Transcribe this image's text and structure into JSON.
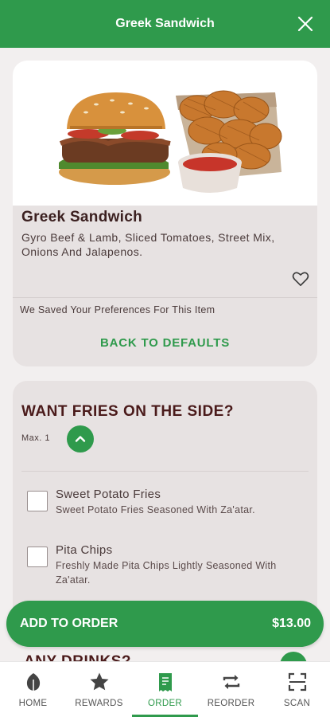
{
  "header": {
    "title": "Greek Sandwich",
    "close_icon": "close-icon"
  },
  "item": {
    "name": "Greek Sandwich",
    "description": "Gyro Beef & Lamb, Sliced Tomatoes, Street Mix, Onions And Jalapenos.",
    "favorite_icon": "heart-outline-icon",
    "preferences_note": "We Saved Your Preferences For This Item",
    "back_to_defaults_label": "BACK TO DEFAULTS"
  },
  "fries_section": {
    "title": "WANT FRIES ON THE SIDE?",
    "max_label": "Max. 1",
    "options": [
      {
        "name": "Sweet Potato Fries",
        "description": "Sweet Potato Fries Seasoned With Za'atar.",
        "checked": false
      },
      {
        "name": "Pita Chips",
        "description": "Freshly Made Pita Chips Lightly Seasoned With Za'atar.",
        "checked": false
      }
    ]
  },
  "next_section_peek": {
    "title": "ANY DRINKS?"
  },
  "add_to_order": {
    "label": "ADD TO ORDER",
    "price": "$13.00"
  },
  "nav": {
    "accent_color": "#2f9a4c",
    "items": [
      {
        "label": "HOME",
        "icon": "leaf-icon"
      },
      {
        "label": "REWARDS",
        "icon": "star-icon"
      },
      {
        "label": "ORDER",
        "icon": "receipt-icon",
        "active": true
      },
      {
        "label": "REORDER",
        "icon": "repeat-icon"
      },
      {
        "label": "SCAN",
        "icon": "scan-icon"
      }
    ]
  }
}
